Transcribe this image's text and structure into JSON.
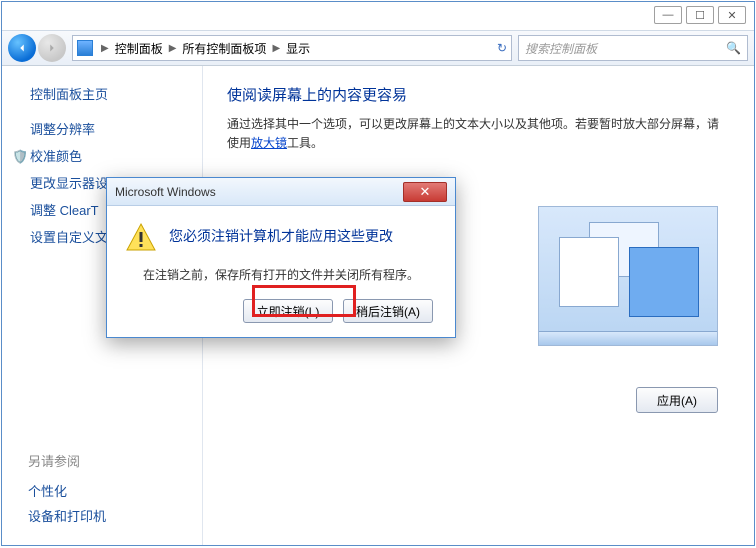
{
  "window_controls": {
    "min": "—",
    "max": "☐",
    "close": "✕"
  },
  "breadcrumb": {
    "items": [
      "控制面板",
      "所有控制面板项",
      "显示"
    ]
  },
  "search": {
    "placeholder": "搜索控制面板"
  },
  "sidebar": {
    "title": "控制面板主页",
    "items": [
      {
        "label": "调整分辨率"
      },
      {
        "label": "校准颜色"
      },
      {
        "label": "更改显示器设"
      },
      {
        "label": "调整 ClearT"
      },
      {
        "label": "设置自定义文"
      }
    ],
    "see_also_hdr": "另请参阅",
    "see_also": [
      "个性化",
      "设备和打印机"
    ]
  },
  "main": {
    "heading": "使阅读屏幕上的内容更容易",
    "desc_prefix": "通过选择其中一个选项，可以更改屏幕上的文本大小以及其他项。若要暂时放大部分屏幕，请使用",
    "desc_link": "放大镜",
    "desc_suffix": "工具。",
    "apply_label": "应用(A)"
  },
  "dialog": {
    "title": "Microsoft Windows",
    "heading": "您必须注销计算机才能应用这些更改",
    "message": "在注销之前，保存所有打开的文件并关闭所有程序。",
    "primary": "立即注销(L)",
    "secondary": "稍后注销(A)"
  }
}
